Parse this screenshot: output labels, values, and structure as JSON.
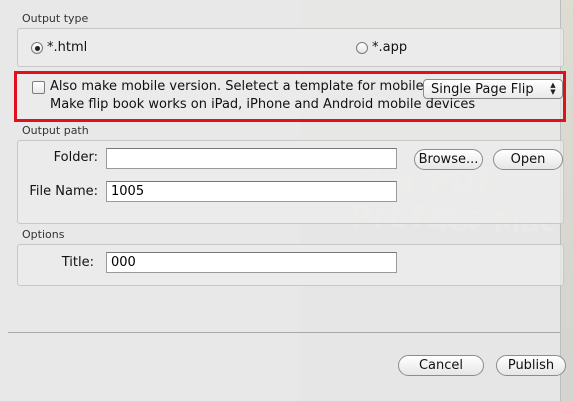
{
  "output_type": {
    "section_label": "Output type",
    "options": [
      {
        "label": "*.html",
        "selected": true
      },
      {
        "label": "*.app",
        "selected": false
      }
    ]
  },
  "mobile": {
    "checkbox_label": "Also make mobile version. Seletect a template for mobile:",
    "checked": false,
    "template_selected": "Single Page Flip",
    "description": "Make flip book works on iPad, iPhone and Android mobile devices",
    "highlight_color": "#e0101e"
  },
  "output_path": {
    "section_label": "Output path",
    "folder_label": "Folder:",
    "folder_value": "",
    "browse_label": "Browse...",
    "open_label": "Open",
    "filename_label": "File Name:",
    "filename_value": "1005"
  },
  "options": {
    "section_label": "Options",
    "title_label": "Title:",
    "title_value": "000"
  },
  "footer": {
    "cancel_label": "Cancel",
    "publish_label": "Publish"
  }
}
